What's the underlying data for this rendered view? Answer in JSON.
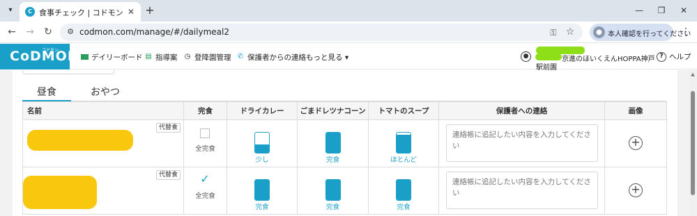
{
  "browser": {
    "tab_title": "食事チェック | コドモン",
    "favicon_letter": "C",
    "url": "codmon.com/manage/#/dailymeal2",
    "profile_label": "本人確認を行ってください",
    "icons": [
      "tab-list-icon",
      "close-icon",
      "new-tab-icon",
      "minimize-icon",
      "maximize-icon",
      "window-close-icon",
      "back-icon",
      "forward-icon",
      "reload-icon",
      "site-info-icon",
      "key-icon",
      "star-icon",
      "menu-dots-icon"
    ]
  },
  "app": {
    "logo": "CoDMON",
    "logo_small": "コドモン",
    "nav": [
      {
        "label": "デイリーボード",
        "icon": "board-icon"
      },
      {
        "label": "指導案",
        "icon": "document-icon"
      },
      {
        "label": "登降園管理",
        "icon": "clock-icon"
      },
      {
        "label": "保護者からの連絡",
        "icon": "phone-icon"
      },
      {
        "label": "もっと見る ▾",
        "icon": ""
      }
    ],
    "facility_name": "京進のほいくえんHOPPA神戸",
    "facility_sub": "駅前園",
    "help": "ヘルプ"
  },
  "meal_tabs": [
    {
      "label": "昼食",
      "active": true
    },
    {
      "label": "おやつ",
      "active": false
    }
  ],
  "table": {
    "headers": {
      "name": "名前",
      "done": "完食",
      "food1": "ドライカレー",
      "food2": "ごまドレツナコーン",
      "food3": "トマトのスープ",
      "memo": "保護者への連絡",
      "image": "画像"
    },
    "rows": [
      {
        "alt_badge": "代替食",
        "done_checked": false,
        "done_label": "全完食",
        "foods": [
          {
            "label": "少し",
            "level": 0.4
          },
          {
            "label": "完食",
            "level": 1.0
          },
          {
            "label": "ほとんど",
            "level": 0.9
          }
        ],
        "memo_placeholder": "連絡帳に追記したい内容を入力してください"
      },
      {
        "alt_badge": "代替食",
        "done_checked": true,
        "done_label": "全完食",
        "foods": [
          {
            "label": "完食",
            "level": 1.0
          },
          {
            "label": "完食",
            "level": 1.0
          },
          {
            "label": "完食",
            "level": 1.0
          }
        ],
        "memo_placeholder": "連絡帳に追記したい内容を入力してください"
      }
    ]
  },
  "colors": {
    "accent": "#1aa0c8",
    "redaction_yellow": "#f9c80e",
    "redaction_green": "#8ede18"
  }
}
